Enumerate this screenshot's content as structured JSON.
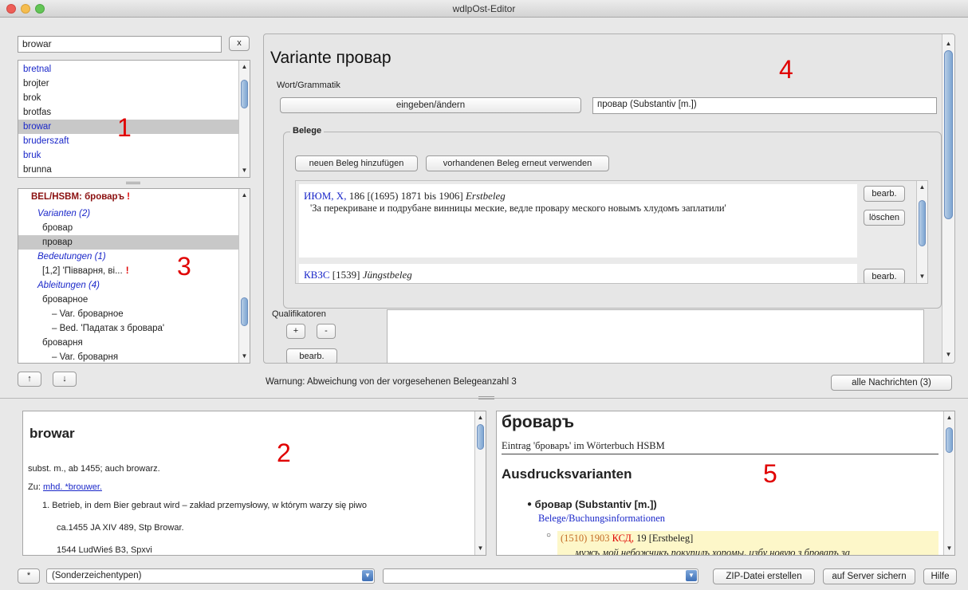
{
  "window": {
    "title": "wdlpOst-Editor"
  },
  "search": {
    "value": "browar",
    "clear_label": "x"
  },
  "word_list": {
    "items": [
      {
        "label": "bretnal",
        "blue": true
      },
      {
        "label": "brojter",
        "blue": false
      },
      {
        "label": "brok",
        "blue": false
      },
      {
        "label": "brotfas",
        "blue": false
      },
      {
        "label": "browar",
        "blue": true
      },
      {
        "label": "bruderszaft",
        "blue": true
      },
      {
        "label": "bruk",
        "blue": true
      },
      {
        "label": "brunna",
        "blue": false
      }
    ]
  },
  "tree": {
    "header": "BEL/HSBM: бровар",
    "header_mark": "!",
    "items": [
      {
        "label": "Varianten (2)"
      },
      {
        "label": "бровар"
      },
      {
        "label": "провар"
      },
      {
        "label": "Bedeutungen (1)"
      },
      {
        "label": "[1,2] 'Півварня, ві...",
        "mark": "!"
      },
      {
        "label": "Ableitungen (4)"
      },
      {
        "label": "броварное"
      },
      {
        "label": "– Var. броварное"
      },
      {
        "label": "– Bed. 'Падатак з бровара'"
      },
      {
        "label": "броварня"
      },
      {
        "label": "– Var. броварня"
      }
    ]
  },
  "nav": {
    "up_label": "↑",
    "down_label": "↓"
  },
  "labels": {
    "n1": "1",
    "n2": "2",
    "n3": "3",
    "n4": "4",
    "n5": "5"
  },
  "editor": {
    "title": "Variante провар",
    "wort_label": "Wort/Grammatik",
    "edit_btn": "eingeben/ändern",
    "wort_value": "провар (Substantiv [m.])",
    "belege_legend": "Belege",
    "new_beleg_btn": "neuen Beleg hinzufügen",
    "reuse_beleg_btn": "vorhandenen Beleg erneut verwenden",
    "beleg1": {
      "source": "ИЮМ, Х,",
      "info": "186 [(1695) 1871 bis 1906]",
      "type": "Erstbeleg",
      "quote": "'За перекриване и подрубане винницы меские, ведле провару меского новымъ хлудомъ заплатили'",
      "edit_btn": "bearb.",
      "delete_btn": "löschen"
    },
    "beleg2": {
      "source": "КВЗС",
      "info": "[1539]",
      "type": "Jüngstbeleg",
      "edit_btn": "bearb."
    },
    "qual_label": "Qualifikatoren",
    "qual_plus": "+",
    "qual_minus": "-",
    "qual_edit": "bearb."
  },
  "status": {
    "warning": "Warnung: Abweichung von der vorgesehenen Belegeanzahl 3",
    "messages_btn": "alle Nachrichten (3)"
  },
  "dict": {
    "headword": "browar",
    "grammar": "subst. m., ab 1455; auch browarz.",
    "zu_label": "Zu:",
    "zu_link": "mhd. *brouwer.",
    "sense": "1. Betrieb, in dem Bier gebraut wird – zakład przemysłowy, w którym warzy się piwo",
    "cite1": "ca.1455 JA XIV 489, Stp Browar.",
    "cite2": "1544 LudWieś B3, Spxvi"
  },
  "preview": {
    "headword": "броваръ",
    "subtitle": "Eintrag 'броваръ' im Wörterbuch HSBM",
    "section": "Ausdrucksvarianten",
    "variant": "бровар (Substantiv [m.])",
    "link": "Belege/Buchungsinformationen",
    "beleg_date": "(1510) 1903",
    "beleg_src": "КСД,",
    "beleg_rest": "19 [Erstbeleg]",
    "beleg_quote": "мужъ мой небожчикъ покупилъ хоромы, избу новую з броваръ за"
  },
  "bottom": {
    "star_btn": "*",
    "combo1": "(Sonderzeichentypen)",
    "combo2": "",
    "zip_btn": "ZIP-Datei erstellen",
    "save_btn": "auf Server sichern",
    "help_btn": "Hilfe"
  },
  "colors": {
    "red_numbers": "#e00000",
    "link_blue": "#1a27c9",
    "dark_red": "#8b1010",
    "highlight": "#fdf7c9"
  }
}
